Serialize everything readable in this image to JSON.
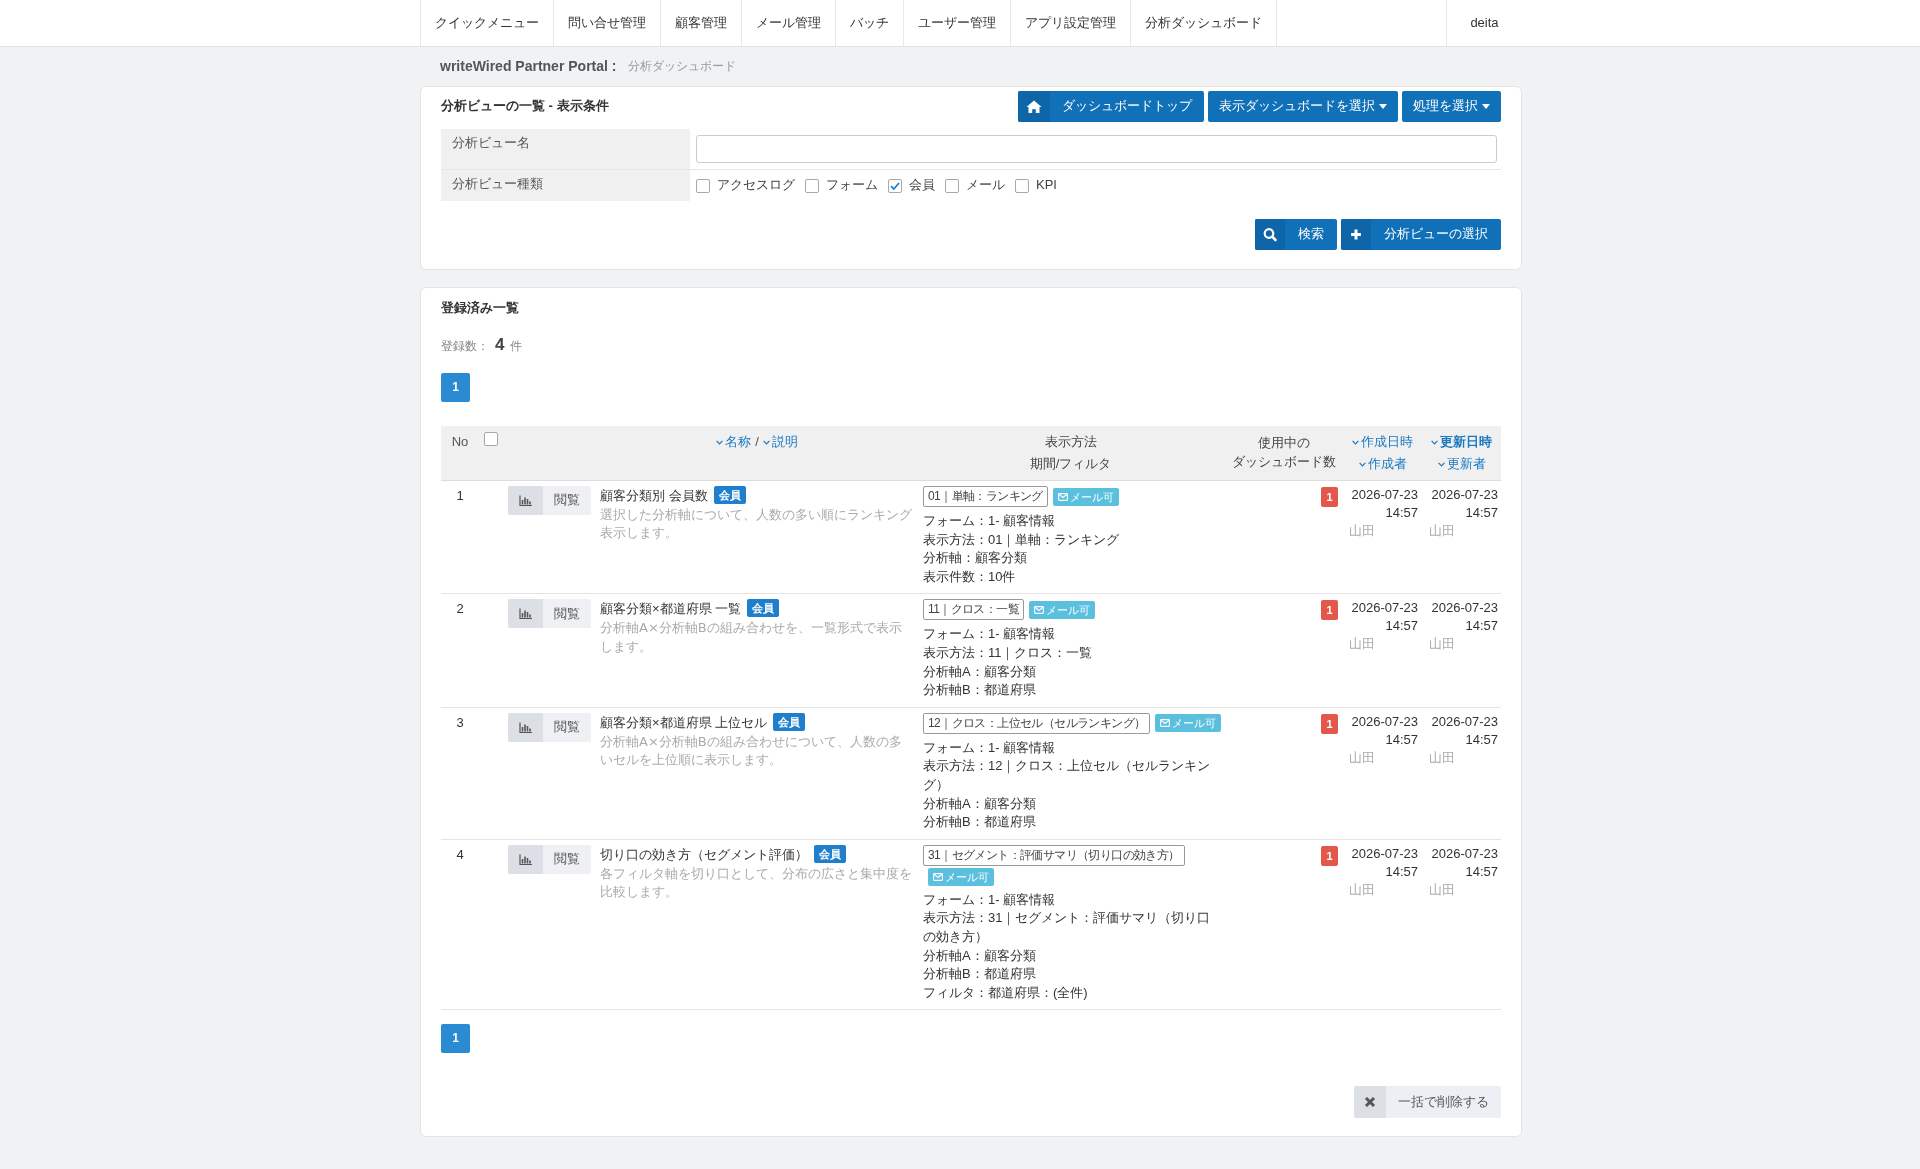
{
  "nav": {
    "items": [
      "クイックメニュー",
      "問い合せ管理",
      "顧客管理",
      "メール管理",
      "バッチ",
      "ユーザー管理",
      "アプリ設定管理",
      "分析ダッシュボード"
    ],
    "user": "deita"
  },
  "breadcrumb": {
    "site": "writeWired Partner Portal :",
    "page": "分析ダッシュボード"
  },
  "filter_panel": {
    "title": "分析ビューの一覧 - 表示条件",
    "toolbar": [
      {
        "kind": "home",
        "label": "ダッシュボードトップ"
      },
      {
        "kind": "dropdown",
        "label": "表示ダッシュボードを選択"
      },
      {
        "kind": "dropdown",
        "label": "処理を選択"
      }
    ],
    "fields": [
      {
        "kind": "text",
        "label": "分析ビュー名"
      },
      {
        "kind": "checkboxes",
        "label": "分析ビュー種類",
        "options": [
          {
            "label": "アクセスログ",
            "checked": false
          },
          {
            "label": "フォーム",
            "checked": false
          },
          {
            "label": "会員",
            "checked": true
          },
          {
            "label": "メール",
            "checked": false
          },
          {
            "label": "KPI",
            "checked": false
          }
        ]
      }
    ],
    "actions": [
      {
        "kind": "search",
        "label": "検索"
      },
      {
        "kind": "add",
        "label": "分析ビューの選択"
      }
    ]
  },
  "list_panel": {
    "title": "登録済み一覧",
    "count": {
      "label": "登録数：",
      "value": "4",
      "unit": "件"
    },
    "pagination_top": [
      {
        "label": "1",
        "selected": true
      }
    ],
    "table": {
      "header": {
        "no": "No",
        "select_all": {
          "checked": false
        },
        "name_sort": [
          {
            "label": "名称",
            "selected": false
          },
          {
            "label": "説明",
            "selected": false
          }
        ],
        "name_separator": "/",
        "method": [
          "表示方法",
          "期間/フィルタ"
        ],
        "dashboards": [
          "使用中の",
          "ダッシュボード数"
        ],
        "created_sort": [
          {
            "label": "作成日時",
            "selected": false
          },
          {
            "label": "作成者",
            "selected": false
          }
        ],
        "updated_sort": [
          {
            "label": "更新日時",
            "selected": true
          },
          {
            "label": "更新者",
            "selected": false
          }
        ]
      },
      "rows": [
        {
          "no": "1",
          "view_button": "閲覧",
          "name": "顧客分類別 会員数",
          "badge": "会員",
          "description": "選択した分析軸について、人数の多い順にランキング表示します。",
          "method_tag": "01｜単軸：ランキング",
          "mail_tag": "メール可",
          "details": [
            "フォーム：1- 顧客情報",
            "表示方法：01｜単軸：ランキング",
            "分析軸：顧客分類",
            "表示件数：10件"
          ],
          "dashboard_count": "1",
          "created": {
            "date": "2026-07-23",
            "time": "14:57",
            "user": "山田"
          },
          "updated": {
            "date": "2026-07-23",
            "time": "14:57",
            "user": "山田"
          }
        },
        {
          "no": "2",
          "view_button": "閲覧",
          "name": "顧客分類×都道府県 一覧",
          "badge": "会員",
          "description": "分析軸A×分析軸Bの組み合わせを、一覧形式で表示します。",
          "method_tag": "11｜クロス：一覧",
          "mail_tag": "メール可",
          "details": [
            "フォーム：1- 顧客情報",
            "表示方法：11｜クロス：一覧",
            "分析軸A：顧客分類",
            "分析軸B：都道府県"
          ],
          "dashboard_count": "1",
          "created": {
            "date": "2026-07-23",
            "time": "14:57",
            "user": "山田"
          },
          "updated": {
            "date": "2026-07-23",
            "time": "14:57",
            "user": "山田"
          }
        },
        {
          "no": "3",
          "view_button": "閲覧",
          "name": "顧客分類×都道府県 上位セル",
          "badge": "会員",
          "description": "分析軸A×分析軸Bの組み合わせについて、人数の多いセルを上位順に表示します。",
          "method_tag": "12｜クロス：上位セル（セルランキング）",
          "mail_tag": "メール可",
          "details": [
            "フォーム：1- 顧客情報",
            "表示方法：12｜クロス：上位セル（セルランキング）",
            "分析軸A：顧客分類",
            "分析軸B：都道府県"
          ],
          "dashboard_count": "1",
          "created": {
            "date": "2026-07-23",
            "time": "14:57",
            "user": "山田"
          },
          "updated": {
            "date": "2026-07-23",
            "time": "14:57",
            "user": "山田"
          }
        },
        {
          "no": "4",
          "view_button": "閲覧",
          "name": "切り口の効き方（セグメント評価）",
          "badge": "会員",
          "description": "各フィルタ軸を切り口として、分布の広さと集中度を比較します。",
          "method_tag": "31｜セグメント：評価サマリ（切り口の効き方）",
          "mail_tag": "メール可",
          "details": [
            "フォーム：1- 顧客情報",
            "表示方法：31｜セグメント：評価サマリ（切り口の効き方）",
            "分析軸A：顧客分類",
            "分析軸B：都道府県",
            "フィルタ：都道府県：(全件)"
          ],
          "dashboard_count": "1",
          "created": {
            "date": "2026-07-23",
            "time": "14:57",
            "user": "山田"
          },
          "updated": {
            "date": "2026-07-23",
            "time": "14:57",
            "user": "山田"
          }
        }
      ]
    },
    "pagination_bottom": [
      {
        "label": "1",
        "selected": true
      }
    ],
    "delete_button": "一括で削除する"
  }
}
